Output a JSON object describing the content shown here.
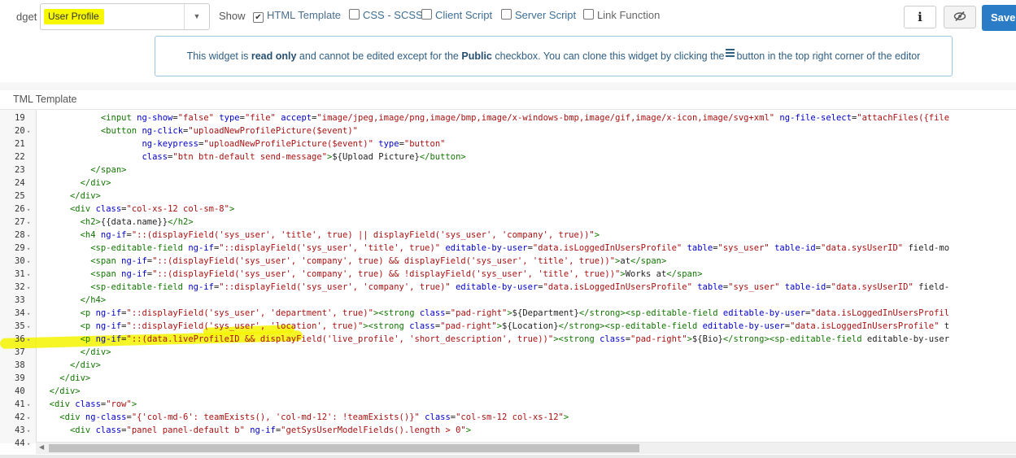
{
  "toolbar": {
    "widget_label": "dget",
    "widget_value": "User Profile",
    "show_label": "Show",
    "checkboxes": [
      {
        "label": "HTML Template",
        "checked": true
      },
      {
        "label": "CSS - SCSS",
        "checked": false
      },
      {
        "label": "Client Script",
        "checked": false
      },
      {
        "label": "Server Script",
        "checked": false
      },
      {
        "label": "Link Function",
        "checked": false
      }
    ],
    "info_button": "i",
    "save_label": "Save"
  },
  "banner": {
    "part1": "This widget is ",
    "bold1": "read only",
    "part2": " and cannot be edited except for the ",
    "bold2": "Public",
    "part3": " checkbox. You can clone this widget by clicking the",
    "part4": "button in the top right corner of the editor"
  },
  "section_title": "TML Template",
  "colors": {
    "highlight": "#f5f500",
    "save": "#2b7cc6",
    "banner_border": "#9fc6dd"
  },
  "code_lines": [
    {
      "n": "19",
      "fold": false,
      "text": "            <input ng-show=\"false\" type=\"file\" accept=\"image/jpeg,image/png,image/bmp,image/x-windows-bmp,image/gif,image/x-icon,image/svg+xml\" ng-file-select=\"attachFiles({file"
    },
    {
      "n": "20",
      "fold": true,
      "text": "            <button ng-click=\"uploadNewProfilePicture($event)\""
    },
    {
      "n": "21",
      "fold": false,
      "text": "                    ng-keypress=\"uploadNewProfilePicture($event)\" type=\"button\""
    },
    {
      "n": "22",
      "fold": false,
      "text": "                    class=\"btn btn-default send-message\">${Upload Picture}</button>"
    },
    {
      "n": "23",
      "fold": false,
      "text": "          </span>"
    },
    {
      "n": "24",
      "fold": false,
      "text": "        </div>"
    },
    {
      "n": "25",
      "fold": false,
      "text": "      </div>"
    },
    {
      "n": "26",
      "fold": true,
      "text": "      <div class=\"col-xs-12 col-sm-8\">"
    },
    {
      "n": "27",
      "fold": true,
      "text": "        <h2>{{data.name}}</h2>"
    },
    {
      "n": "28",
      "fold": true,
      "text": "        <h4 ng-if=\"::(displayField('sys_user', 'title', true) || displayField('sys_user', 'company', true))\">"
    },
    {
      "n": "29",
      "fold": true,
      "text": "          <sp-editable-field ng-if=\"::displayField('sys_user', 'title', true)\" editable-by-user=\"data.isLoggedInUsersProfile\" table=\"sys_user\" table-id=\"data.sysUserID\" field-mo"
    },
    {
      "n": "30",
      "fold": true,
      "text": "          <span ng-if=\"::(displayField('sys_user', 'company', true) && displayField('sys_user', 'title', true))\">at</span>"
    },
    {
      "n": "31",
      "fold": true,
      "text": "          <span ng-if=\"::(displayField('sys_user', 'company', true) && !displayField('sys_user', 'title', true))\">Works at</span>"
    },
    {
      "n": "32",
      "fold": true,
      "text": "          <sp-editable-field ng-if=\"::displayField('sys_user', 'company', true)\" editable-by-user=\"data.isLoggedInUsersProfile\" table=\"sys_user\" table-id=\"data.sysUserID\" field-"
    },
    {
      "n": "33",
      "fold": false,
      "text": "        </h4>"
    },
    {
      "n": "34",
      "fold": true,
      "text": "        <p ng-if=\"::displayField('sys_user', 'department', true)\"><strong class=\"pad-right\">${Department}</strong><sp-editable-field editable-by-user=\"data.isLoggedInUsersProfil"
    },
    {
      "n": "35",
      "fold": true,
      "text": "        <p ng-if=\"::displayField('sys_user', 'location', true)\"><strong class=\"pad-right\">${Location}</strong><sp-editable-field editable-by-user=\"data.isLoggedInUsersProfile\" t"
    },
    {
      "n": "36",
      "fold": true,
      "text": "        <p ng-if=\"::(data.liveProfileID && displayField('live_profile', 'short_description', true))\"><strong class=\"pad-right\">${Bio}</strong><sp-editable-field editable-by-user"
    },
    {
      "n": "37",
      "fold": false,
      "text": "        </div>"
    },
    {
      "n": "38",
      "fold": false,
      "text": "      </div>"
    },
    {
      "n": "39",
      "fold": false,
      "text": "    </div>"
    },
    {
      "n": "40",
      "fold": false,
      "text": "  </div>"
    },
    {
      "n": "41",
      "fold": true,
      "text": "  <div class=\"row\">"
    },
    {
      "n": "42",
      "fold": true,
      "text": "    <div ng-class=\"{'col-md-6': teamExists(), 'col-md-12': !teamExists()}\" class=\"col-sm-12 col-xs-12\">"
    },
    {
      "n": "43",
      "fold": true,
      "text": "      <div class=\"panel panel-default b\" ng-if=\"getSysUserModelFields().length > 0\">"
    },
    {
      "n": "44",
      "fold": true,
      "text": ""
    }
  ]
}
